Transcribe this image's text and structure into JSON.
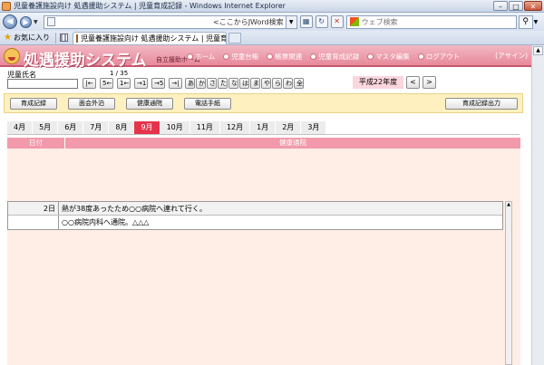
{
  "window": {
    "title": "児童養護施設向け 処遇援助システム | 児童育成記録 - Windows Internet Explorer",
    "min_label": "–",
    "max_label": "□",
    "close_label": "✕"
  },
  "addressbar": {
    "search_provider": "<ここからJWord検索",
    "search_placeholder": "ウェブ検索",
    "search_icon_label": "⚲"
  },
  "favorites": {
    "label": "お気に入り",
    "tab_title": "児童養護施設向け 処遇援助システム | 児童育成..."
  },
  "header": {
    "brand": "処遇援助システム",
    "sub": "自立援助ホーム",
    "nav": [
      "ホーム",
      "児童台帳",
      "帳票関連",
      "児童育成記録",
      "マスタ編集",
      "ログアウト"
    ],
    "signout": "(アサイン)"
  },
  "child": {
    "name_label": "児童氏名",
    "counter": "1 / 35",
    "pager": [
      "|←",
      "5←",
      "1←",
      "→1",
      "→5",
      "→|"
    ],
    "kana": [
      "あ",
      "か",
      "さ",
      "た",
      "な",
      "は",
      "ま",
      "や",
      "ら",
      "わ",
      "全"
    ]
  },
  "year": {
    "label": "平成22年度",
    "prev": "<",
    "next": ">"
  },
  "toolbar": {
    "buttons": [
      "育成記録",
      "面会外泊",
      "健康通院",
      "電話手紙"
    ],
    "output": "育成記録出力"
  },
  "months": {
    "items": [
      "4月",
      "5月",
      "6月",
      "7月",
      "8月",
      "9月",
      "10月",
      "11月",
      "12月",
      "1月",
      "2月",
      "3月"
    ],
    "active": "9月"
  },
  "table": {
    "col_date": "日付",
    "col_health": "健康通院",
    "rows": [
      {
        "day": "2日",
        "text": "熱が38度あったため○○病院へ連れて行く。"
      },
      {
        "day": "",
        "text": "○○病院内科へ通院。△△△"
      }
    ]
  },
  "colors": {
    "header_pink": "#e7899b",
    "active_month": "#e5334b",
    "toolbar_bg": "#fff1bf",
    "content_bg": "#ffeee5"
  }
}
